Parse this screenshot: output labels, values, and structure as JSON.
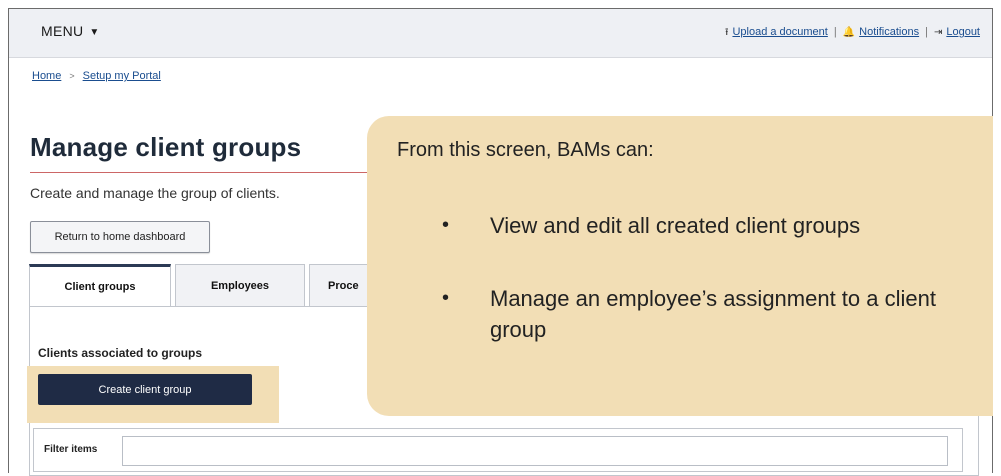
{
  "header": {
    "menu_label": "MENU",
    "upload_label": "Upload a document",
    "notifications_label": "Notifications",
    "logout_label": "Logout",
    "separator": "|"
  },
  "breadcrumb": {
    "home": "Home",
    "separator": ">",
    "current": "Setup my Portal"
  },
  "page": {
    "title": "Manage client groups",
    "subtitle": "Create and manage the group of clients.",
    "return_button": "Return to home dashboard"
  },
  "tabs": [
    {
      "label": "Client groups",
      "active": true
    },
    {
      "label": "Employees",
      "active": false
    },
    {
      "label": "Proce",
      "active": false
    }
  ],
  "panel": {
    "section_label": "Clients associated to groups",
    "create_button": "Create client group",
    "filter_label": "Filter items",
    "filter_value": ""
  },
  "callout": {
    "heading": "From this screen, BAMs can:",
    "bullet_char": "•",
    "bullets": [
      "View and edit all created client groups",
      "Manage an employee’s assignment to a client group"
    ]
  },
  "colors": {
    "callout_bg": "#f2deb5",
    "primary_button": "#1f2b45",
    "link": "#1a4d8f",
    "topbar_bg": "#eef0f4"
  },
  "icons": {
    "menu": "chevron-down-icon",
    "upload": "upload-icon",
    "notifications": "bell-icon",
    "logout": "logout-icon",
    "breadcrumb": "chevron-right-icon"
  }
}
